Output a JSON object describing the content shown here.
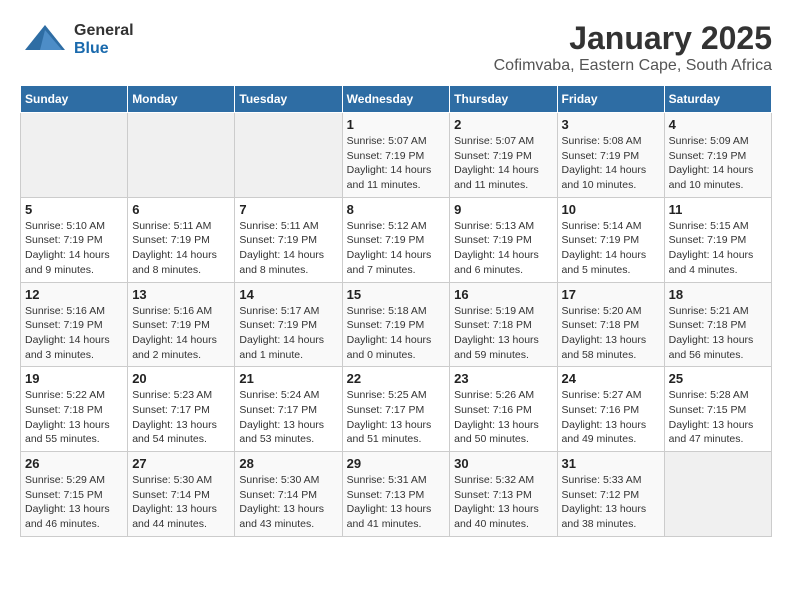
{
  "header": {
    "logo": {
      "general": "General",
      "blue": "Blue"
    },
    "title": "January 2025",
    "subtitle": "Cofimvaba, Eastern Cape, South Africa"
  },
  "calendar": {
    "weekdays": [
      "Sunday",
      "Monday",
      "Tuesday",
      "Wednesday",
      "Thursday",
      "Friday",
      "Saturday"
    ],
    "weeks": [
      [
        {
          "day": "",
          "info": ""
        },
        {
          "day": "",
          "info": ""
        },
        {
          "day": "",
          "info": ""
        },
        {
          "day": "1",
          "info": "Sunrise: 5:07 AM\nSunset: 7:19 PM\nDaylight: 14 hours\nand 11 minutes."
        },
        {
          "day": "2",
          "info": "Sunrise: 5:07 AM\nSunset: 7:19 PM\nDaylight: 14 hours\nand 11 minutes."
        },
        {
          "day": "3",
          "info": "Sunrise: 5:08 AM\nSunset: 7:19 PM\nDaylight: 14 hours\nand 10 minutes."
        },
        {
          "day": "4",
          "info": "Sunrise: 5:09 AM\nSunset: 7:19 PM\nDaylight: 14 hours\nand 10 minutes."
        }
      ],
      [
        {
          "day": "5",
          "info": "Sunrise: 5:10 AM\nSunset: 7:19 PM\nDaylight: 14 hours\nand 9 minutes."
        },
        {
          "day": "6",
          "info": "Sunrise: 5:11 AM\nSunset: 7:19 PM\nDaylight: 14 hours\nand 8 minutes."
        },
        {
          "day": "7",
          "info": "Sunrise: 5:11 AM\nSunset: 7:19 PM\nDaylight: 14 hours\nand 8 minutes."
        },
        {
          "day": "8",
          "info": "Sunrise: 5:12 AM\nSunset: 7:19 PM\nDaylight: 14 hours\nand 7 minutes."
        },
        {
          "day": "9",
          "info": "Sunrise: 5:13 AM\nSunset: 7:19 PM\nDaylight: 14 hours\nand 6 minutes."
        },
        {
          "day": "10",
          "info": "Sunrise: 5:14 AM\nSunset: 7:19 PM\nDaylight: 14 hours\nand 5 minutes."
        },
        {
          "day": "11",
          "info": "Sunrise: 5:15 AM\nSunset: 7:19 PM\nDaylight: 14 hours\nand 4 minutes."
        }
      ],
      [
        {
          "day": "12",
          "info": "Sunrise: 5:16 AM\nSunset: 7:19 PM\nDaylight: 14 hours\nand 3 minutes."
        },
        {
          "day": "13",
          "info": "Sunrise: 5:16 AM\nSunset: 7:19 PM\nDaylight: 14 hours\nand 2 minutes."
        },
        {
          "day": "14",
          "info": "Sunrise: 5:17 AM\nSunset: 7:19 PM\nDaylight: 14 hours\nand 1 minute."
        },
        {
          "day": "15",
          "info": "Sunrise: 5:18 AM\nSunset: 7:19 PM\nDaylight: 14 hours\nand 0 minutes."
        },
        {
          "day": "16",
          "info": "Sunrise: 5:19 AM\nSunset: 7:18 PM\nDaylight: 13 hours\nand 59 minutes."
        },
        {
          "day": "17",
          "info": "Sunrise: 5:20 AM\nSunset: 7:18 PM\nDaylight: 13 hours\nand 58 minutes."
        },
        {
          "day": "18",
          "info": "Sunrise: 5:21 AM\nSunset: 7:18 PM\nDaylight: 13 hours\nand 56 minutes."
        }
      ],
      [
        {
          "day": "19",
          "info": "Sunrise: 5:22 AM\nSunset: 7:18 PM\nDaylight: 13 hours\nand 55 minutes."
        },
        {
          "day": "20",
          "info": "Sunrise: 5:23 AM\nSunset: 7:17 PM\nDaylight: 13 hours\nand 54 minutes."
        },
        {
          "day": "21",
          "info": "Sunrise: 5:24 AM\nSunset: 7:17 PM\nDaylight: 13 hours\nand 53 minutes."
        },
        {
          "day": "22",
          "info": "Sunrise: 5:25 AM\nSunset: 7:17 PM\nDaylight: 13 hours\nand 51 minutes."
        },
        {
          "day": "23",
          "info": "Sunrise: 5:26 AM\nSunset: 7:16 PM\nDaylight: 13 hours\nand 50 minutes."
        },
        {
          "day": "24",
          "info": "Sunrise: 5:27 AM\nSunset: 7:16 PM\nDaylight: 13 hours\nand 49 minutes."
        },
        {
          "day": "25",
          "info": "Sunrise: 5:28 AM\nSunset: 7:15 PM\nDaylight: 13 hours\nand 47 minutes."
        }
      ],
      [
        {
          "day": "26",
          "info": "Sunrise: 5:29 AM\nSunset: 7:15 PM\nDaylight: 13 hours\nand 46 minutes."
        },
        {
          "day": "27",
          "info": "Sunrise: 5:30 AM\nSunset: 7:14 PM\nDaylight: 13 hours\nand 44 minutes."
        },
        {
          "day": "28",
          "info": "Sunrise: 5:30 AM\nSunset: 7:14 PM\nDaylight: 13 hours\nand 43 minutes."
        },
        {
          "day": "29",
          "info": "Sunrise: 5:31 AM\nSunset: 7:13 PM\nDaylight: 13 hours\nand 41 minutes."
        },
        {
          "day": "30",
          "info": "Sunrise: 5:32 AM\nSunset: 7:13 PM\nDaylight: 13 hours\nand 40 minutes."
        },
        {
          "day": "31",
          "info": "Sunrise: 5:33 AM\nSunset: 7:12 PM\nDaylight: 13 hours\nand 38 minutes."
        },
        {
          "day": "",
          "info": ""
        }
      ]
    ]
  }
}
